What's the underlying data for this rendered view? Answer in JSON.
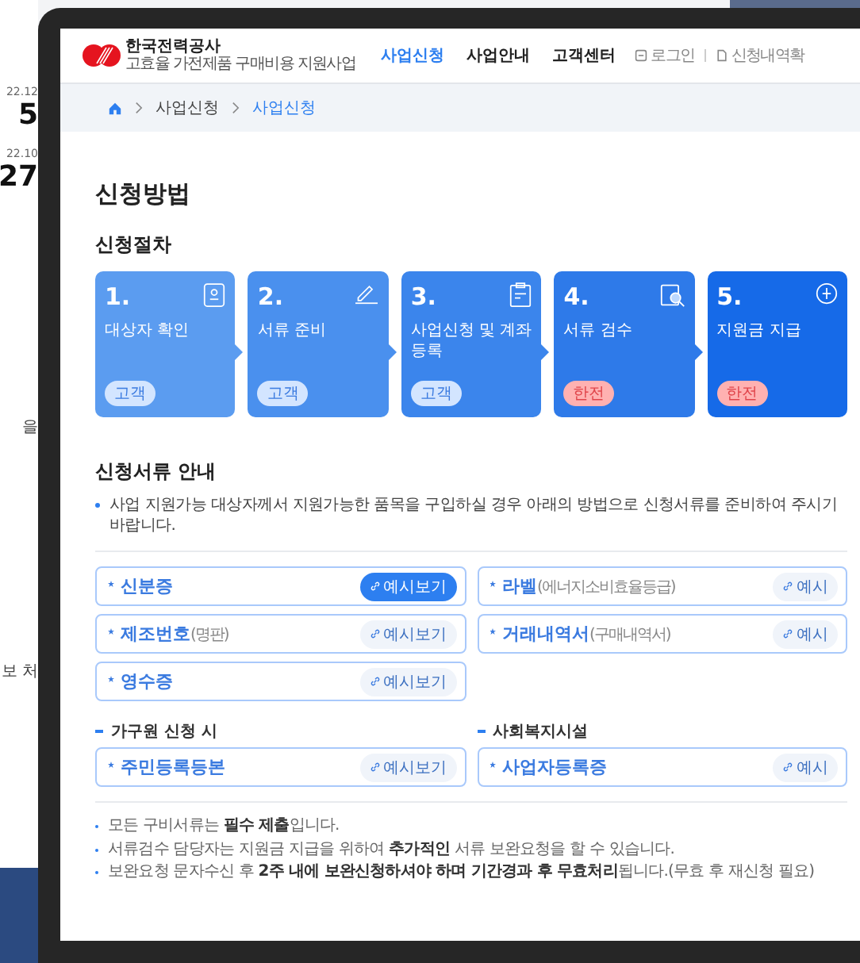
{
  "background_page": {
    "texts": [
      {
        "text": "22.12",
        "kind": "date"
      },
      {
        "text": "5",
        "kind": "big"
      },
      {
        "text": "22.10",
        "kind": "date"
      },
      {
        "text": "27",
        "kind": "big"
      },
      {
        "text": "을",
        "kind": "line"
      },
      {
        "text": "보 처",
        "kind": "line"
      }
    ]
  },
  "header": {
    "logo_title": "한국전력공사",
    "logo_subtitle": "고효율 가전제품 구매비용 지원사업",
    "nav": [
      {
        "label": "사업신청",
        "selected": true
      },
      {
        "label": "사업안내",
        "selected": false
      },
      {
        "label": "고객센터",
        "selected": false
      }
    ],
    "utility_links": [
      "로그인",
      "신청내역확"
    ]
  },
  "breadcrumb": [
    {
      "label": "사업신청",
      "selected": false
    },
    {
      "label": "사업신청",
      "selected": true
    }
  ],
  "page_title": "신청방법",
  "procedure": {
    "title": "신청절차",
    "steps": [
      {
        "number": "1.",
        "title": "대상자 확인",
        "color": "#5b9cf0",
        "badge": {
          "text": "고객",
          "color": "#d3e5ff"
        }
      },
      {
        "number": "2.",
        "title": "서류 준비",
        "color": "#4a90ee",
        "badge": {
          "text": "고객",
          "color": "#d3e5ff"
        }
      },
      {
        "number": "3.",
        "title": "사업신청 및 계좌등록",
        "color": "#3b85ec",
        "badge": {
          "text": "고객",
          "color": "#d3e5ff"
        }
      },
      {
        "number": "4.",
        "title": "서류 검수",
        "color": "#2e7ae9",
        "badge": {
          "text": "한전",
          "color": "#ffb1b1"
        }
      },
      {
        "number": "5.",
        "title": "지원금 지급",
        "color": "#166ae8",
        "badge": {
          "text": "한전",
          "color": "#ffb1b1"
        }
      }
    ]
  },
  "documents": {
    "title": "신청서류 안내",
    "intro": "사업 지원가능 대상자께서 지원가능한 품목을 구입하실 경우 아래의 방법으로 신청서류를 준비하여 주시기 바랍니다.",
    "items": [
      {
        "label": "신분증",
        "button": "예시보기",
        "selected": true
      },
      {
        "label": "라벨",
        "note": "(에너지소비효율등급)",
        "button": "예시",
        "selected": false
      },
      {
        "label": "제조번호",
        "note": "(명판)",
        "button": "예시보기",
        "selected": false
      },
      {
        "label": "거래내역서",
        "note": "(구매내역서)",
        "button": "예시",
        "selected": false
      },
      {
        "label": "영수증",
        "button": "예시보기",
        "selected": false
      }
    ],
    "groups": [
      {
        "title": "가구원 신청 시",
        "items": [
          {
            "label": "주민등록등본",
            "button": "예시보기",
            "selected": false
          }
        ]
      },
      {
        "title": "사회복지시설",
        "items": [
          {
            "label": "사업자등록증",
            "button": "예시",
            "selected": false
          }
        ]
      }
    ]
  },
  "notes": [
    "모든 구비서류는 **필수 제출**입니다.",
    "서류검수 담당자는 지원금 지급을 위하여 **추가적인** 서류 보완요청을 할 수 있습니다.",
    "보완요청 문자수신 후 **2주 내에 보완신청하셔야 하며 기간경과 후 무효처리**됩니다.(무효 후 재신청 필요)"
  ]
}
